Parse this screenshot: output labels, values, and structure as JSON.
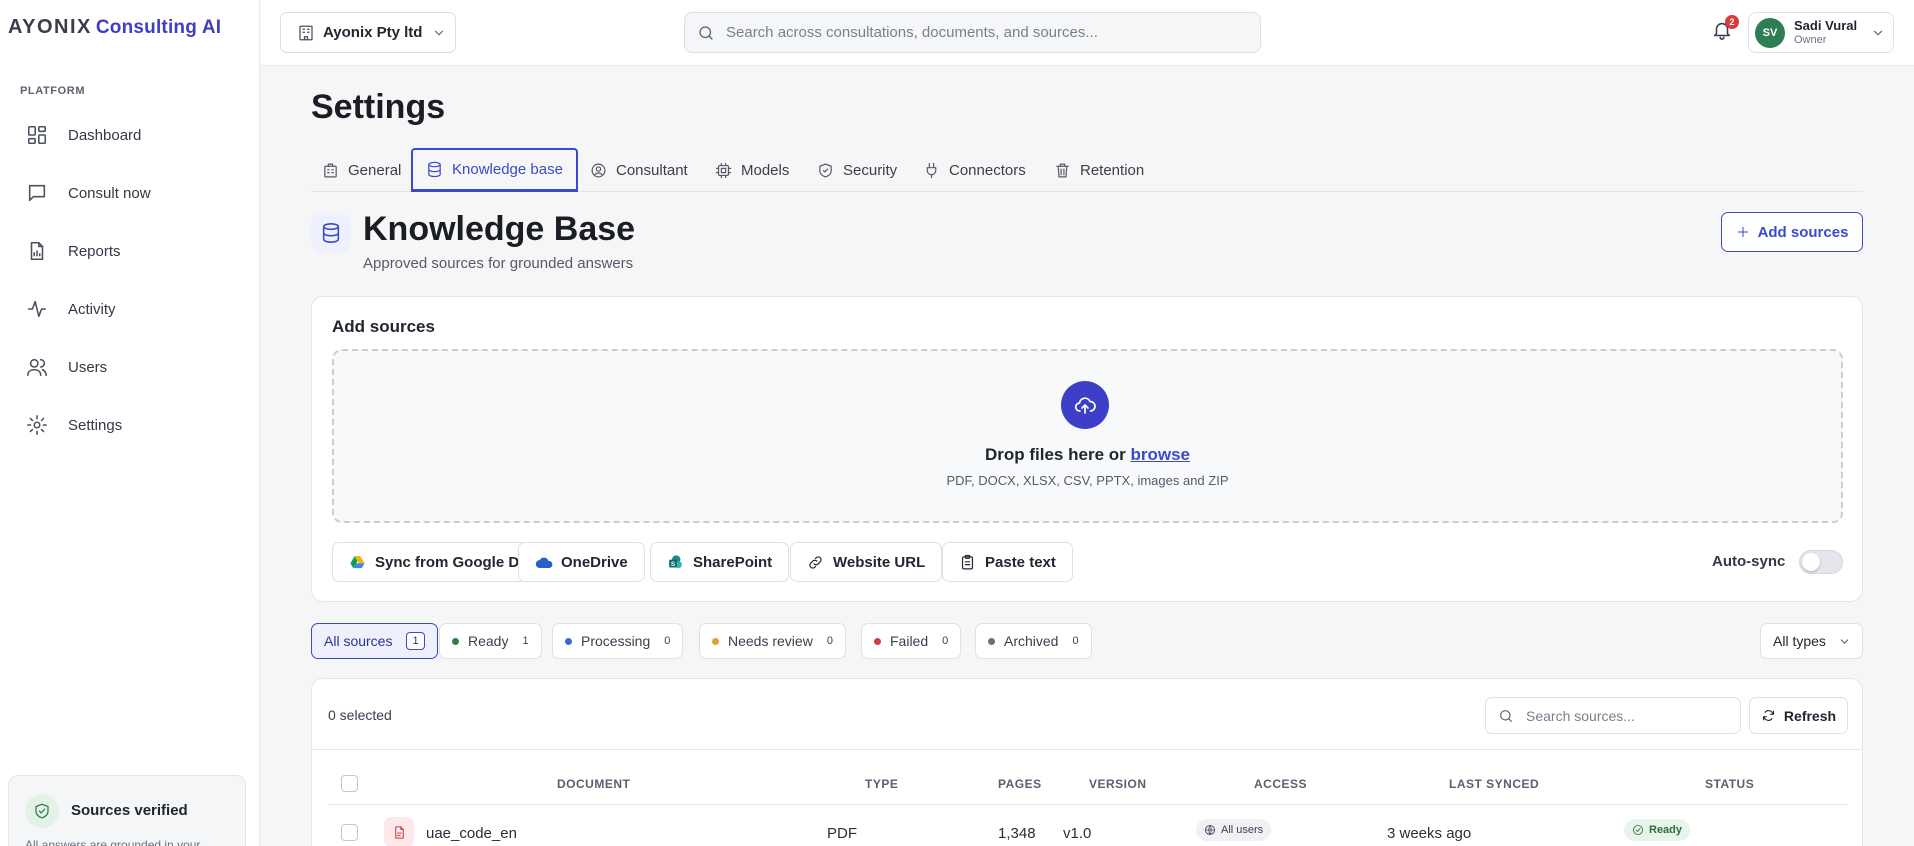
{
  "brand": {
    "mark": "AYONIX",
    "product": "Consulting AI"
  },
  "sidebar": {
    "section_label": "PLATFORM",
    "items": [
      {
        "label": "Dashboard",
        "icon": "dashboard-icon"
      },
      {
        "label": "Consult now",
        "icon": "chat-icon"
      },
      {
        "label": "Reports",
        "icon": "report-icon"
      },
      {
        "label": "Activity",
        "icon": "activity-icon"
      },
      {
        "label": "Users",
        "icon": "users-icon"
      },
      {
        "label": "Settings",
        "icon": "gear-icon"
      }
    ],
    "verify_card": {
      "title": "Sources verified",
      "description": "All answers are grounded in your"
    }
  },
  "topbar": {
    "org_name": "Ayonix Pty ltd",
    "search_placeholder": "Search across consultations, documents, and sources...",
    "notification_count": "2",
    "user": {
      "initials": "SV",
      "name": "Sadi Vural",
      "role": "Owner"
    }
  },
  "page": {
    "title": "Settings",
    "tabs": [
      {
        "label": "General",
        "icon": "building-icon",
        "active": false
      },
      {
        "label": "Knowledge base",
        "icon": "database-icon",
        "active": true
      },
      {
        "label": "Consultant",
        "icon": "user-circle-icon",
        "active": false
      },
      {
        "label": "Models",
        "icon": "cpu-icon",
        "active": false
      },
      {
        "label": "Security",
        "icon": "shield-icon",
        "active": false
      },
      {
        "label": "Connectors",
        "icon": "plug-icon",
        "active": false
      },
      {
        "label": "Retention",
        "icon": "trash-icon",
        "active": false
      }
    ]
  },
  "kb": {
    "title": "Knowledge Base",
    "subtitle": "Approved sources for grounded answers",
    "add_button": "Add sources"
  },
  "add_card": {
    "heading": "Add sources",
    "drop_text": "Drop files here or",
    "browse_link": "browse",
    "formats": "PDF, DOCX, XLSX, CSV, PPTX, images and ZIP",
    "source_buttons": [
      {
        "label": "Sync from Google Drive",
        "icon": "google-drive-icon"
      },
      {
        "label": "OneDrive",
        "icon": "onedrive-icon"
      },
      {
        "label": "SharePoint",
        "icon": "sharepoint-icon"
      },
      {
        "label": "Website URL",
        "icon": "link-icon"
      },
      {
        "label": "Paste text",
        "icon": "clipboard-icon"
      }
    ],
    "auto_sync_label": "Auto-sync",
    "auto_sync_on": false
  },
  "filters": {
    "chips": [
      {
        "label": "All sources",
        "count": "1",
        "active": true,
        "color": ""
      },
      {
        "label": "Ready",
        "count": "1",
        "active": false,
        "color": "#2f7d4a"
      },
      {
        "label": "Processing",
        "count": "0",
        "active": false,
        "color": "#3a6ad8"
      },
      {
        "label": "Needs review",
        "count": "0",
        "active": false,
        "color": "#e0a030"
      },
      {
        "label": "Failed",
        "count": "0",
        "active": false,
        "color": "#d23c3c"
      },
      {
        "label": "Archived",
        "count": "0",
        "active": false,
        "color": "#6b7080"
      }
    ],
    "type_select": "All types"
  },
  "table": {
    "selected_text": "0 selected",
    "search_placeholder": "Search sources...",
    "refresh_label": "Refresh",
    "columns": [
      "DOCUMENT",
      "TYPE",
      "PAGES",
      "VERSION",
      "ACCESS",
      "LAST SYNCED",
      "STATUS"
    ],
    "rows": [
      {
        "document": "uae_code_en",
        "type": "PDF",
        "pages": "1,348",
        "version": "v1.0",
        "access": "All users",
        "last_synced": "3 weeks ago",
        "status": "Ready"
      }
    ]
  }
}
